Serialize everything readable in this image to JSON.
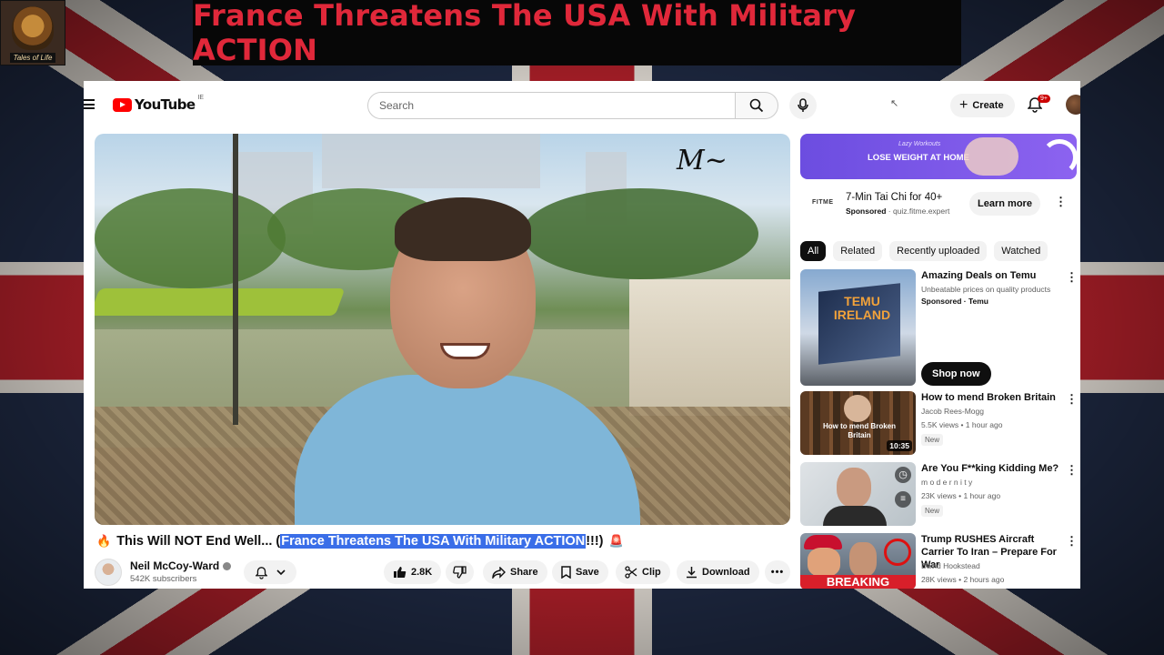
{
  "overlay": {
    "banner_title": "France Threatens The USA With Military ACTION",
    "logo_caption": "Tales of Life"
  },
  "header": {
    "brand": "YouTube",
    "region": "IE",
    "search_placeholder": "Search",
    "create_label": "Create",
    "notifications_badge": "9+"
  },
  "video": {
    "title_prefix": "This Will NOT End Well... (",
    "title_highlight": "France Threatens The USA With Military ACTION",
    "title_suffix": "!!!)",
    "channel": "Neil McCoy-Ward",
    "subscribers": "542K subscribers",
    "likes": "2.8K",
    "share_label": "Share",
    "save_label": "Save",
    "clip_label": "Clip",
    "download_label": "Download"
  },
  "ad": {
    "banner_small": "Lazy Workouts",
    "banner_text": "LOSE WEIGHT AT HOME",
    "brand": "FITME",
    "title": "7-Min Tai Chi for 40+",
    "sponsored": "Sponsored",
    "domain": "quiz.fitme.expert",
    "cta": "Learn more"
  },
  "chips": [
    "All",
    "Related",
    "Recently uploaded",
    "Watched"
  ],
  "recommendations": [
    {
      "title": "Amazing Deals on Temu",
      "line2": "Unbeatable prices on quality products",
      "line3": "Sponsored · Temu",
      "cta": "Shop now",
      "thumb_text": "TEMU IRELAND"
    },
    {
      "title": "How to mend Broken Britain",
      "channel": "Jacob Rees-Mogg",
      "meta": "5.5K views • 1 hour ago",
      "badge": "New",
      "duration": "10:35",
      "thumb_text": "How to mend Broken Britain"
    },
    {
      "title": "Are You F**king Kidding Me?",
      "channel": "m o d e r n i t y",
      "meta": "23K views • 1 hour ago",
      "badge": "New"
    },
    {
      "title": "Trump RUSHES Aircraft Carrier To Iran – Prepare For War",
      "channel": "David Hookstead",
      "meta": "28K views • 2 hours ago",
      "thumb_text": "BREAKING"
    }
  ],
  "colors": {
    "banner_red": "#e0283a",
    "youtube_red": "#ff0000",
    "highlight_blue": "#3a6ee8"
  }
}
